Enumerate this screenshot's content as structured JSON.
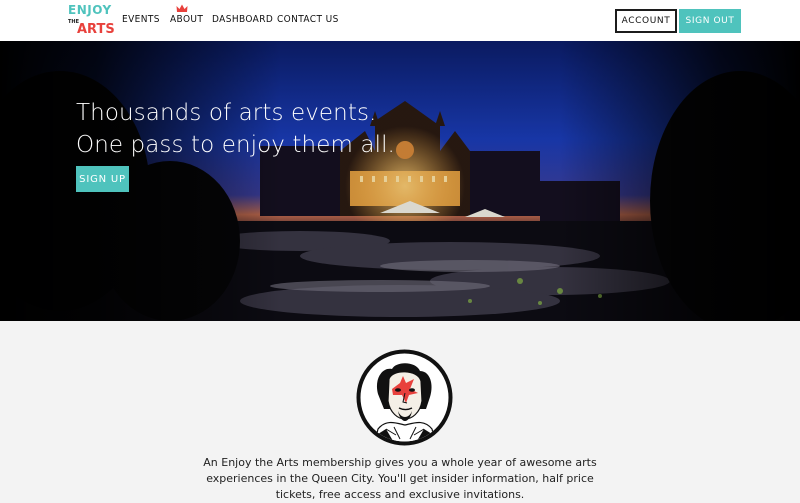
{
  "brand": {
    "logo_word1": "ENJOY",
    "logo_word2": "THE",
    "logo_word3": "ARTS",
    "colors": {
      "teal": "#4fc3bd",
      "red": "#e8413c",
      "dark": "#1c1c1c"
    }
  },
  "nav": {
    "items": [
      {
        "label": "EVENTS"
      },
      {
        "label": "ABOUT"
      },
      {
        "label": "DASHBOARD"
      },
      {
        "label": "CONTACT US"
      }
    ],
    "account_label": "ACCOUNT",
    "signout_label": "SIGN OUT",
    "crown_icon": "crown-icon"
  },
  "hero": {
    "headline_line1": "Thousands of arts events.",
    "headline_line2": "One pass to enjoy them all.",
    "signup_label": "SIGN UP"
  },
  "info": {
    "avatar_icon": "shakespeare-portrait-icon",
    "text": "An Enjoy the Arts membership gives you a whole year of awesome arts experiences in the Queen City. You'll get insider information, half price tickets, free access and exclusive invitations."
  }
}
